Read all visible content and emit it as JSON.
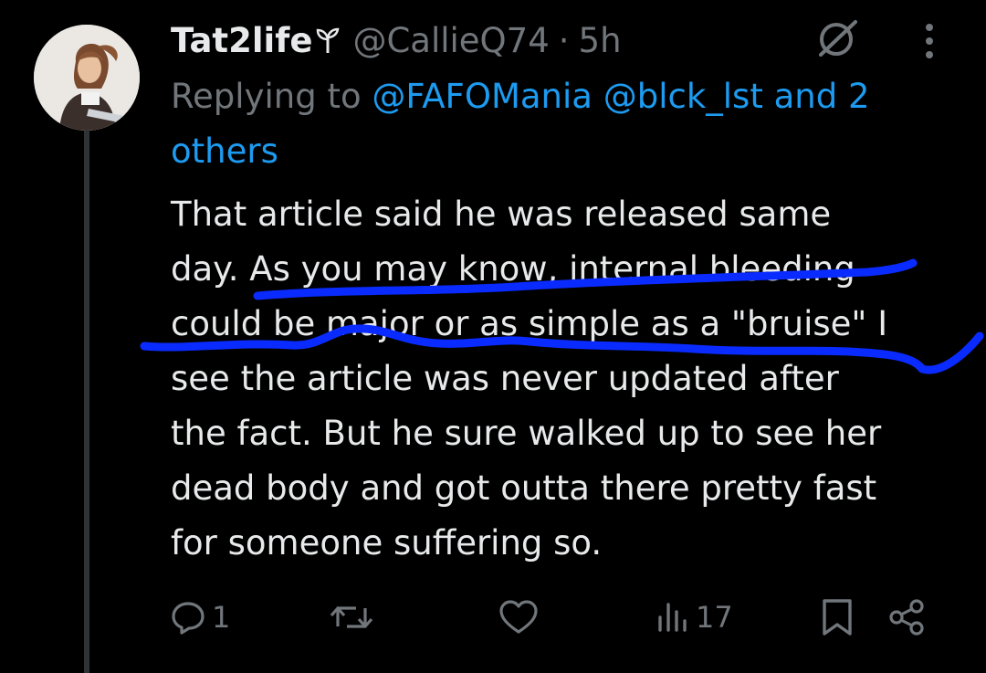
{
  "tweet": {
    "display_name": "Tat2life",
    "badge_icon": "plant-emoji-icon",
    "handle": "@CallieQ74",
    "separator": "·",
    "time": "5h",
    "replying_prefix": "Replying to ",
    "reply_mention_1": "@FAFOMania",
    "reply_mention_2": "@blck_lst and 2 others",
    "text_line_1": "That article said he was released same",
    "text_line_2": "day. As you may know, internal bleeding",
    "text_line_3": "could be major or as simple as a \"bruise\" I",
    "text_line_4": "see the article was never updated after",
    "text_line_5": "the fact. But he sure walked up to see her",
    "text_line_6": "dead body and got outta there pretty fast",
    "text_line_7": "for someone suffering so.",
    "annotation_color": "#0a2bff"
  },
  "actions": {
    "reply_count": "1",
    "retweet_count": "",
    "like_count": "",
    "view_count": "17"
  },
  "colors": {
    "background": "#000000",
    "text": "#e7e9ea",
    "muted": "#71767b",
    "link": "#1d9bf0"
  }
}
